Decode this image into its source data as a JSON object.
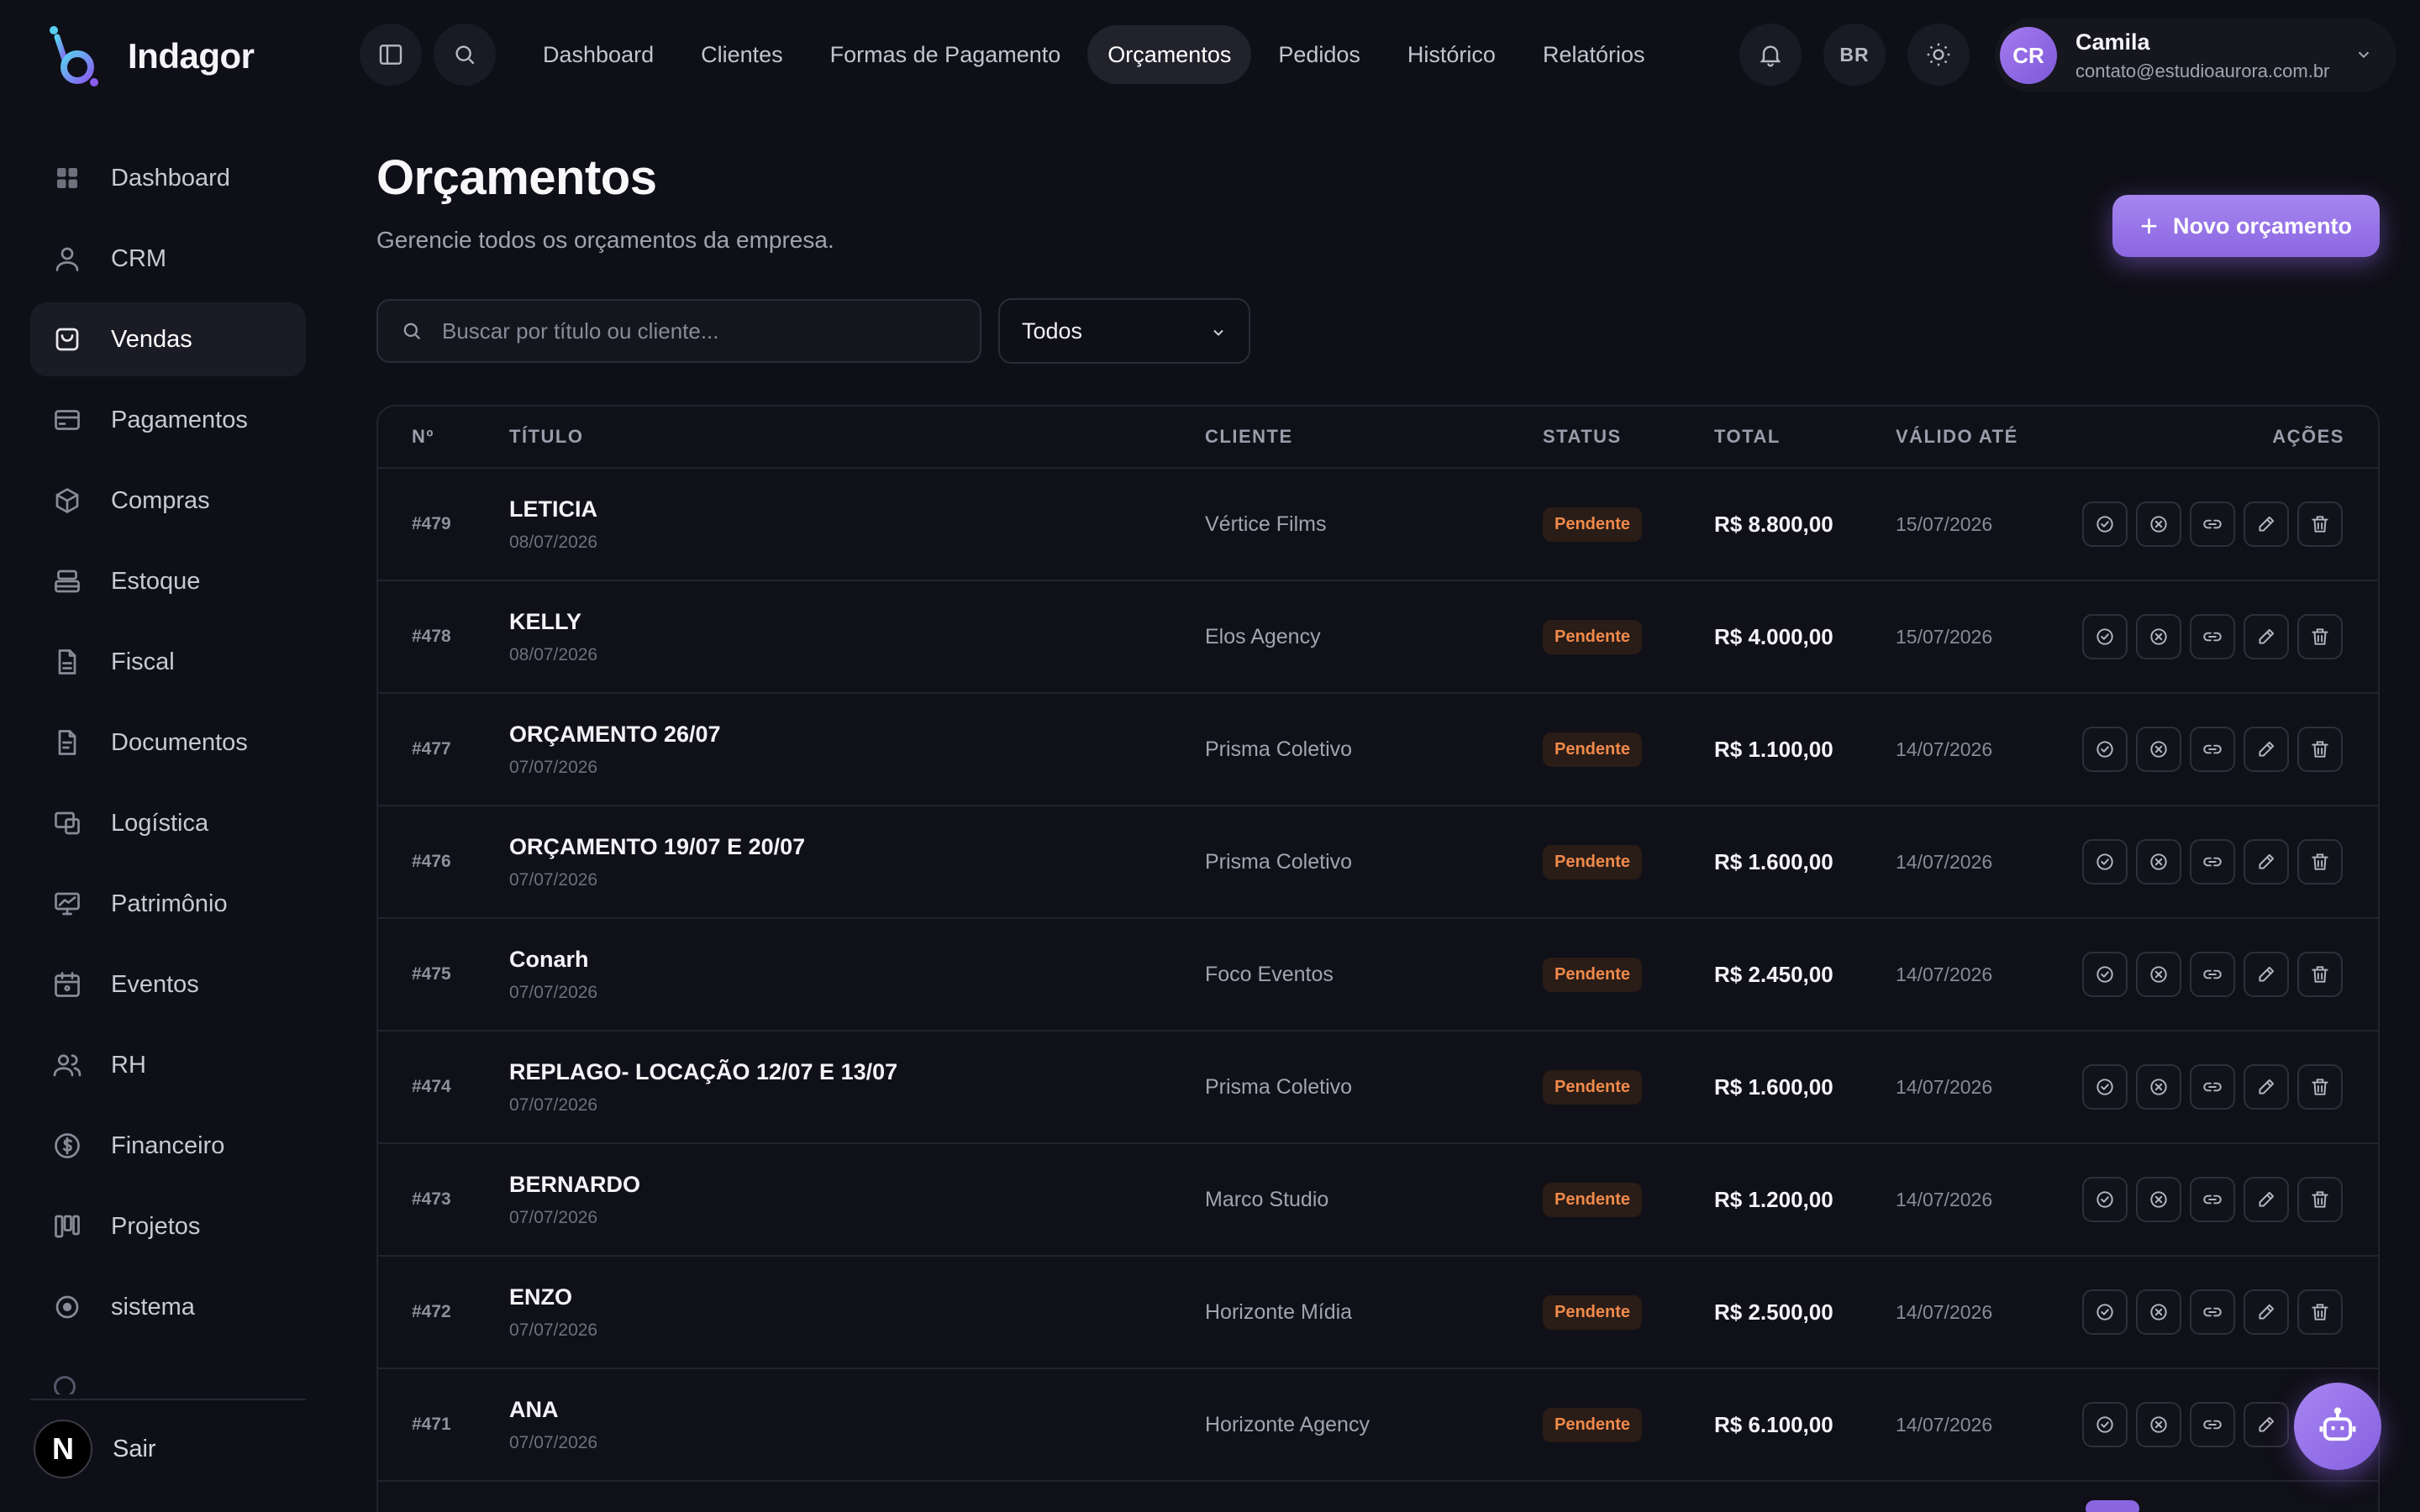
{
  "app": {
    "name": "Indagor"
  },
  "sidebar": {
    "items": [
      {
        "label": "Dashboard",
        "icon": "grid-icon",
        "active": false
      },
      {
        "label": "CRM",
        "icon": "user-icon",
        "active": false
      },
      {
        "label": "Vendas",
        "icon": "shopping-bag-icon",
        "active": true
      },
      {
        "label": "Pagamentos",
        "icon": "credit-card-icon",
        "active": false
      },
      {
        "label": "Compras",
        "icon": "box-icon",
        "active": false
      },
      {
        "label": "Estoque",
        "icon": "stack-icon",
        "active": false
      },
      {
        "label": "Fiscal",
        "icon": "file-icon",
        "active": false
      },
      {
        "label": "Documentos",
        "icon": "document-icon",
        "active": false
      },
      {
        "label": "Logística",
        "icon": "devices-icon",
        "active": false
      },
      {
        "label": "Patrimônio",
        "icon": "monitor-chart-icon",
        "active": false
      },
      {
        "label": "Eventos",
        "icon": "calendar-icon",
        "active": false
      },
      {
        "label": "RH",
        "icon": "users-icon",
        "active": false
      },
      {
        "label": "Financeiro",
        "icon": "dollar-circle-icon",
        "active": false
      },
      {
        "label": "Projetos",
        "icon": "kanban-icon",
        "active": false
      },
      {
        "label": "sistema",
        "icon": "circle-dot-icon",
        "active": false
      }
    ],
    "logout": {
      "label": "Sair",
      "avatar_letter": "N"
    }
  },
  "topbar": {
    "tabs": [
      {
        "label": "Dashboard",
        "active": false
      },
      {
        "label": "Clientes",
        "active": false
      },
      {
        "label": "Formas de Pagamento",
        "active": false
      },
      {
        "label": "Orçamentos",
        "active": true
      },
      {
        "label": "Pedidos",
        "active": false
      },
      {
        "label": "Histórico",
        "active": false
      },
      {
        "label": "Relatórios",
        "active": false
      }
    ],
    "language": "BR",
    "user": {
      "initials": "CR",
      "name": "Camila",
      "email": "contato@estudioaurora.com.br"
    }
  },
  "page": {
    "title": "Orçamentos",
    "subtitle": "Gerencie todos os orçamentos da empresa.",
    "new_button": "Novo orçamento",
    "search_placeholder": "Buscar por título ou cliente...",
    "filter_value": "Todos"
  },
  "table": {
    "headers": {
      "num": "Nº",
      "title": "TÍTULO",
      "client": "CLIENTE",
      "status": "STATUS",
      "total": "TOTAL",
      "valid": "VÁLIDO ATÉ",
      "actions": "AÇÕES"
    },
    "rows": [
      {
        "num": "#479",
        "title": "LETICIA",
        "date": "08/07/2026",
        "client": "Vértice Films",
        "status": "Pendente",
        "total": "R$ 8.800,00",
        "valid": "15/07/2026"
      },
      {
        "num": "#478",
        "title": "KELLY",
        "date": "08/07/2026",
        "client": "Elos Agency",
        "status": "Pendente",
        "total": "R$ 4.000,00",
        "valid": "15/07/2026"
      },
      {
        "num": "#477",
        "title": "ORÇAMENTO 26/07",
        "date": "07/07/2026",
        "client": "Prisma Coletivo",
        "status": "Pendente",
        "total": "R$ 1.100,00",
        "valid": "14/07/2026"
      },
      {
        "num": "#476",
        "title": "ORÇAMENTO 19/07 E 20/07",
        "date": "07/07/2026",
        "client": "Prisma Coletivo",
        "status": "Pendente",
        "total": "R$ 1.600,00",
        "valid": "14/07/2026"
      },
      {
        "num": "#475",
        "title": "Conarh",
        "date": "07/07/2026",
        "client": "Foco Eventos",
        "status": "Pendente",
        "total": "R$ 2.450,00",
        "valid": "14/07/2026"
      },
      {
        "num": "#474",
        "title": "REPLAGO- LOCAÇÃO 12/07 E 13/07",
        "date": "07/07/2026",
        "client": "Prisma Coletivo",
        "status": "Pendente",
        "total": "R$ 1.600,00",
        "valid": "14/07/2026"
      },
      {
        "num": "#473",
        "title": "BERNARDO",
        "date": "07/07/2026",
        "client": "Marco Studio",
        "status": "Pendente",
        "total": "R$ 1.200,00",
        "valid": "14/07/2026"
      },
      {
        "num": "#472",
        "title": "ENZO",
        "date": "07/07/2026",
        "client": "Horizonte Mídia",
        "status": "Pendente",
        "total": "R$ 2.500,00",
        "valid": "14/07/2026"
      },
      {
        "num": "#471",
        "title": "ANA",
        "date": "07/07/2026",
        "client": "Horizonte Agency",
        "status": "Pendente",
        "total": "R$ 6.100,00",
        "valid": "14/07/2026"
      }
    ],
    "row_actions": [
      "approve-icon",
      "reject-icon",
      "link-icon",
      "edit-icon",
      "trash-icon"
    ]
  },
  "colors": {
    "accent": "#8a66e0",
    "pending": "#f08a4b",
    "background": "#0f0f17"
  }
}
